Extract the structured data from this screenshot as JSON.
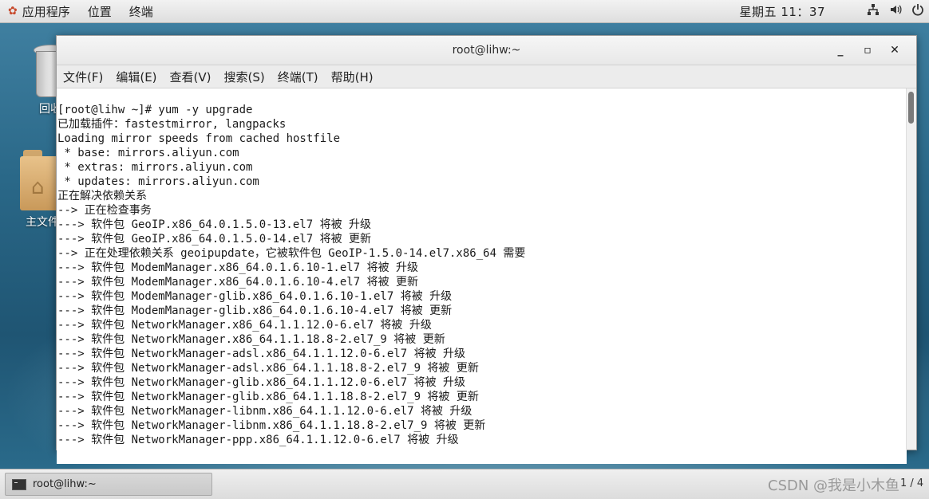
{
  "top_panel": {
    "menus": [
      "应用程序",
      "位置",
      "终端"
    ],
    "clock": "星期五 11：37",
    "tray_icons": [
      "network-icon",
      "volume-icon",
      "power-icon"
    ]
  },
  "desktop": {
    "icons": [
      {
        "label": "回收",
        "icon": "trash-icon"
      },
      {
        "label": "主文件",
        "icon": "home-folder-icon"
      }
    ]
  },
  "window": {
    "title": "root@lihw:~",
    "menu": [
      "文件(F)",
      "编辑(E)",
      "查看(V)",
      "搜索(S)",
      "终端(T)",
      "帮助(H)"
    ]
  },
  "terminal": {
    "lines": [
      "[root@lihw ~]# yum -y upgrade",
      "已加载插件：fastestmirror, langpacks",
      "Loading mirror speeds from cached hostfile",
      " * base: mirrors.aliyun.com",
      " * extras: mirrors.aliyun.com",
      " * updates: mirrors.aliyun.com",
      "正在解决依赖关系",
      "--> 正在检查事务",
      "---> 软件包 GeoIP.x86_64.0.1.5.0-13.el7 将被 升级",
      "---> 软件包 GeoIP.x86_64.0.1.5.0-14.el7 将被 更新",
      "--> 正在处理依赖关系 geoipupdate，它被软件包 GeoIP-1.5.0-14.el7.x86_64 需要",
      "---> 软件包 ModemManager.x86_64.0.1.6.10-1.el7 将被 升级",
      "---> 软件包 ModemManager.x86_64.0.1.6.10-4.el7 将被 更新",
      "---> 软件包 ModemManager-glib.x86_64.0.1.6.10-1.el7 将被 升级",
      "---> 软件包 ModemManager-glib.x86_64.0.1.6.10-4.el7 将被 更新",
      "---> 软件包 NetworkManager.x86_64.1.1.12.0-6.el7 将被 升级",
      "---> 软件包 NetworkManager.x86_64.1.1.18.8-2.el7_9 将被 更新",
      "---> 软件包 NetworkManager-adsl.x86_64.1.1.12.0-6.el7 将被 升级",
      "---> 软件包 NetworkManager-adsl.x86_64.1.1.18.8-2.el7_9 将被 更新",
      "---> 软件包 NetworkManager-glib.x86_64.1.1.12.0-6.el7 将被 升级",
      "---> 软件包 NetworkManager-glib.x86_64.1.1.18.8-2.el7_9 将被 更新",
      "---> 软件包 NetworkManager-libnm.x86_64.1.1.12.0-6.el7 将被 升级",
      "---> 软件包 NetworkManager-libnm.x86_64.1.1.18.8-2.el7_9 将被 更新",
      "---> 软件包 NetworkManager-ppp.x86_64.1.1.12.0-6.el7 将被 升级"
    ]
  },
  "taskbar": {
    "task_label": "root@lihw:~",
    "pager": "1 / 4"
  },
  "watermark": "CSDN @我是小木鱼"
}
